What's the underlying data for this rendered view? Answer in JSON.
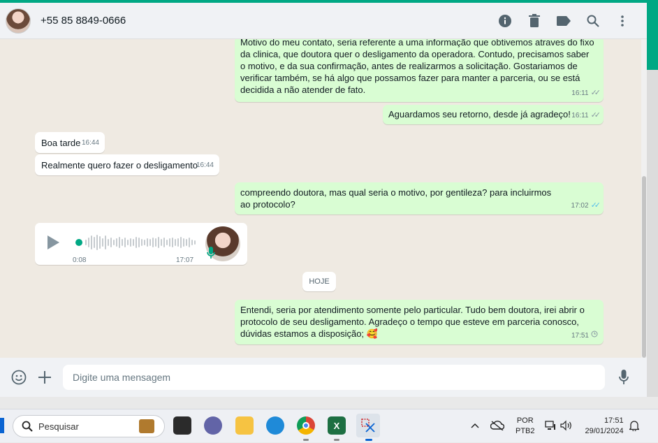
{
  "header": {
    "contact_name": "+55 85 8849-0666",
    "icons": [
      "info-icon",
      "trash-icon",
      "label-icon",
      "search-icon",
      "menu-icon"
    ]
  },
  "messages": [
    {
      "dir": "out",
      "text": "Motivo do meu contato, seria referente a uma informação que obtivemos atraves do fixo da clinica, que doutora quer o desligamento da operadora. Contudo, precisamos saber o motivo, e da sua confirmação, antes de realizarmos a solicitação. Gostariamos de verificar também, se há algo que possamos fazer para manter a parceria, ou se está decidida a não atender de fato.",
      "time": "16:11",
      "status": "read-gray"
    },
    {
      "dir": "out",
      "text": "Aguardamos seu retorno, desde já agradeço!",
      "time": "16:11",
      "status": "read-gray"
    },
    {
      "dir": "in",
      "text": "Boa tarde",
      "time": "16:44"
    },
    {
      "dir": "in",
      "text": "Realmente quero fazer o desligamento",
      "time": "16:44"
    },
    {
      "dir": "out",
      "text": "compreendo doutora, mas qual seria o motivo, por gentileza? para incluirmos ao protocolo?",
      "time": "17:02",
      "status": "read"
    },
    {
      "dir": "in",
      "type": "audio",
      "duration": "0:08",
      "time": "17:07"
    },
    {
      "dir": "out",
      "text": "Entendi, seria por atendimento somente pelo particular. Tudo bem doutora, irei abrir o protocolo de seu desligamento. Agradeço o tempo que esteve em parceria conosco, dúvidas estamos a disposição; 🥰",
      "time": "17:51",
      "status": "pending"
    }
  ],
  "day_chip": "HOJE",
  "composer": {
    "placeholder": "Digite uma mensagem"
  },
  "taskbar": {
    "search_label": "Pesquisar",
    "lang_top": "POR",
    "lang_bottom": "PTB2",
    "time": "17:51",
    "date": "29/01/2024"
  },
  "colors": {
    "accent": "#00a884",
    "outgoing_bubble": "#d9fdd3",
    "read_ticks": "#53bdeb"
  }
}
